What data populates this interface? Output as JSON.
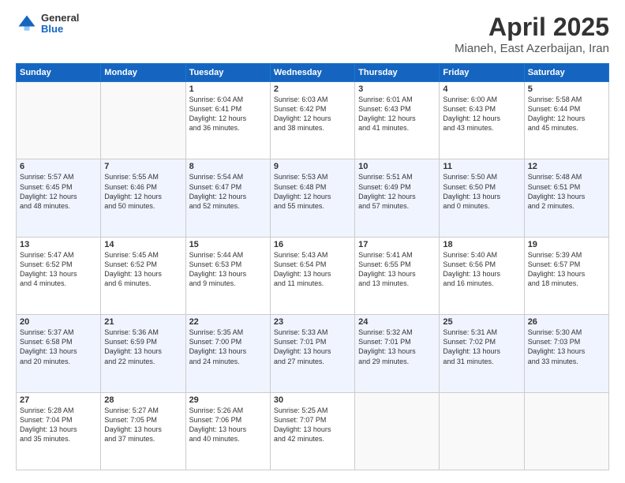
{
  "logo": {
    "general": "General",
    "blue": "Blue"
  },
  "title": "April 2025",
  "subtitle": "Mianeh, East Azerbaijan, Iran",
  "days": [
    "Sunday",
    "Monday",
    "Tuesday",
    "Wednesday",
    "Thursday",
    "Friday",
    "Saturday"
  ],
  "weeks": [
    [
      {
        "day": "",
        "info": ""
      },
      {
        "day": "",
        "info": ""
      },
      {
        "day": "1",
        "info": "Sunrise: 6:04 AM\nSunset: 6:41 PM\nDaylight: 12 hours\nand 36 minutes."
      },
      {
        "day": "2",
        "info": "Sunrise: 6:03 AM\nSunset: 6:42 PM\nDaylight: 12 hours\nand 38 minutes."
      },
      {
        "day": "3",
        "info": "Sunrise: 6:01 AM\nSunset: 6:43 PM\nDaylight: 12 hours\nand 41 minutes."
      },
      {
        "day": "4",
        "info": "Sunrise: 6:00 AM\nSunset: 6:43 PM\nDaylight: 12 hours\nand 43 minutes."
      },
      {
        "day": "5",
        "info": "Sunrise: 5:58 AM\nSunset: 6:44 PM\nDaylight: 12 hours\nand 45 minutes."
      }
    ],
    [
      {
        "day": "6",
        "info": "Sunrise: 5:57 AM\nSunset: 6:45 PM\nDaylight: 12 hours\nand 48 minutes."
      },
      {
        "day": "7",
        "info": "Sunrise: 5:55 AM\nSunset: 6:46 PM\nDaylight: 12 hours\nand 50 minutes."
      },
      {
        "day": "8",
        "info": "Sunrise: 5:54 AM\nSunset: 6:47 PM\nDaylight: 12 hours\nand 52 minutes."
      },
      {
        "day": "9",
        "info": "Sunrise: 5:53 AM\nSunset: 6:48 PM\nDaylight: 12 hours\nand 55 minutes."
      },
      {
        "day": "10",
        "info": "Sunrise: 5:51 AM\nSunset: 6:49 PM\nDaylight: 12 hours\nand 57 minutes."
      },
      {
        "day": "11",
        "info": "Sunrise: 5:50 AM\nSunset: 6:50 PM\nDaylight: 13 hours\nand 0 minutes."
      },
      {
        "day": "12",
        "info": "Sunrise: 5:48 AM\nSunset: 6:51 PM\nDaylight: 13 hours\nand 2 minutes."
      }
    ],
    [
      {
        "day": "13",
        "info": "Sunrise: 5:47 AM\nSunset: 6:52 PM\nDaylight: 13 hours\nand 4 minutes."
      },
      {
        "day": "14",
        "info": "Sunrise: 5:45 AM\nSunset: 6:52 PM\nDaylight: 13 hours\nand 6 minutes."
      },
      {
        "day": "15",
        "info": "Sunrise: 5:44 AM\nSunset: 6:53 PM\nDaylight: 13 hours\nand 9 minutes."
      },
      {
        "day": "16",
        "info": "Sunrise: 5:43 AM\nSunset: 6:54 PM\nDaylight: 13 hours\nand 11 minutes."
      },
      {
        "day": "17",
        "info": "Sunrise: 5:41 AM\nSunset: 6:55 PM\nDaylight: 13 hours\nand 13 minutes."
      },
      {
        "day": "18",
        "info": "Sunrise: 5:40 AM\nSunset: 6:56 PM\nDaylight: 13 hours\nand 16 minutes."
      },
      {
        "day": "19",
        "info": "Sunrise: 5:39 AM\nSunset: 6:57 PM\nDaylight: 13 hours\nand 18 minutes."
      }
    ],
    [
      {
        "day": "20",
        "info": "Sunrise: 5:37 AM\nSunset: 6:58 PM\nDaylight: 13 hours\nand 20 minutes."
      },
      {
        "day": "21",
        "info": "Sunrise: 5:36 AM\nSunset: 6:59 PM\nDaylight: 13 hours\nand 22 minutes."
      },
      {
        "day": "22",
        "info": "Sunrise: 5:35 AM\nSunset: 7:00 PM\nDaylight: 13 hours\nand 24 minutes."
      },
      {
        "day": "23",
        "info": "Sunrise: 5:33 AM\nSunset: 7:01 PM\nDaylight: 13 hours\nand 27 minutes."
      },
      {
        "day": "24",
        "info": "Sunrise: 5:32 AM\nSunset: 7:01 PM\nDaylight: 13 hours\nand 29 minutes."
      },
      {
        "day": "25",
        "info": "Sunrise: 5:31 AM\nSunset: 7:02 PM\nDaylight: 13 hours\nand 31 minutes."
      },
      {
        "day": "26",
        "info": "Sunrise: 5:30 AM\nSunset: 7:03 PM\nDaylight: 13 hours\nand 33 minutes."
      }
    ],
    [
      {
        "day": "27",
        "info": "Sunrise: 5:28 AM\nSunset: 7:04 PM\nDaylight: 13 hours\nand 35 minutes."
      },
      {
        "day": "28",
        "info": "Sunrise: 5:27 AM\nSunset: 7:05 PM\nDaylight: 13 hours\nand 37 minutes."
      },
      {
        "day": "29",
        "info": "Sunrise: 5:26 AM\nSunset: 7:06 PM\nDaylight: 13 hours\nand 40 minutes."
      },
      {
        "day": "30",
        "info": "Sunrise: 5:25 AM\nSunset: 7:07 PM\nDaylight: 13 hours\nand 42 minutes."
      },
      {
        "day": "",
        "info": ""
      },
      {
        "day": "",
        "info": ""
      },
      {
        "day": "",
        "info": ""
      }
    ]
  ]
}
